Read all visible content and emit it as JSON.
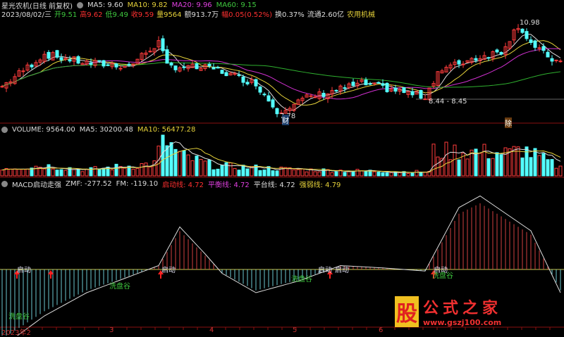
{
  "header": {
    "title": "星光农机(日线 前复权)",
    "ma5": "MA5: 9.60",
    "ma10": "MA10: 9.82",
    "ma20": "MA20: 9.96",
    "ma60": "MA60: 9.15",
    "date": "2023/08/02/三",
    "open": "开9.51",
    "high": "高9.62",
    "low": "低9.49",
    "close": "收9.59",
    "volume": "量9564",
    "amount": "额913.7万",
    "change": "幅0.05(0.52%)",
    "turnover": "换0.37%",
    "float": "流通2.60亿",
    "sector": "农用机械"
  },
  "price_labels": {
    "high": "10.98",
    "low": "7.78",
    "range": "8.44 - 8.45",
    "cai": "财",
    "chu": "除"
  },
  "volume_panel": {
    "volume": "VOLUME: 9564.00",
    "ma5": "MA5: 30200.48",
    "ma10": "MA10: 56477.28"
  },
  "macd_panel": {
    "name": "MACD启动走强",
    "zmf": "ZMF: -277.52",
    "fm": "FM: -119.10",
    "start_line": "启动线: 4.72",
    "balance_line": "平衡线: 4.72",
    "platform_line": "平台线: 4.72",
    "strength_line": "强弱线: 4.79",
    "signals": {
      "start": "启动",
      "wash": "洗盘谷"
    }
  },
  "x_axis": [
    "2023年2",
    "3",
    "4",
    "5",
    "6"
  ],
  "watermark": {
    "logo": "股",
    "name": "公式之家",
    "url": "www.gszj100.com"
  },
  "price_keypoints": [
    [
      0,
      8.8
    ],
    [
      10,
      9.9
    ],
    [
      20,
      9.6
    ],
    [
      30,
      9.5
    ],
    [
      37,
      10.3
    ],
    [
      39,
      9.5
    ],
    [
      50,
      9.4
    ],
    [
      60,
      8.9
    ],
    [
      65,
      7.95
    ],
    [
      72,
      8.4
    ],
    [
      85,
      8.9
    ],
    [
      95,
      8.6
    ],
    [
      100,
      8.45
    ],
    [
      103,
      9.3
    ],
    [
      110,
      9.7
    ],
    [
      118,
      10.0
    ],
    [
      122,
      10.9
    ],
    [
      126,
      10.1
    ],
    [
      132,
      9.55
    ]
  ],
  "volume_keypoints": [
    [
      0,
      0.2
    ],
    [
      10,
      0.25
    ],
    [
      20,
      0.15
    ],
    [
      36,
      0.3
    ],
    [
      38,
      0.95
    ],
    [
      42,
      0.5
    ],
    [
      50,
      0.25
    ],
    [
      70,
      0.15
    ],
    [
      95,
      0.1
    ],
    [
      101,
      0.1
    ],
    [
      102,
      0.6
    ],
    [
      110,
      0.6
    ],
    [
      120,
      0.55
    ],
    [
      123,
      0.65
    ],
    [
      132,
      0.2
    ]
  ],
  "macd_keypoints": [
    [
      0,
      -1
    ],
    [
      10,
      -0.6
    ],
    [
      20,
      -0.3
    ],
    [
      37,
      0.05
    ],
    [
      42,
      0.55
    ],
    [
      48,
      0.2
    ],
    [
      52,
      -0.05
    ],
    [
      60,
      -0.3
    ],
    [
      70,
      -0.15
    ],
    [
      80,
      0.05
    ],
    [
      90,
      0.02
    ],
    [
      100,
      -0.02
    ],
    [
      108,
      0.8
    ],
    [
      113,
      0.95
    ],
    [
      125,
      0.5
    ],
    [
      132,
      -0.3
    ]
  ]
}
